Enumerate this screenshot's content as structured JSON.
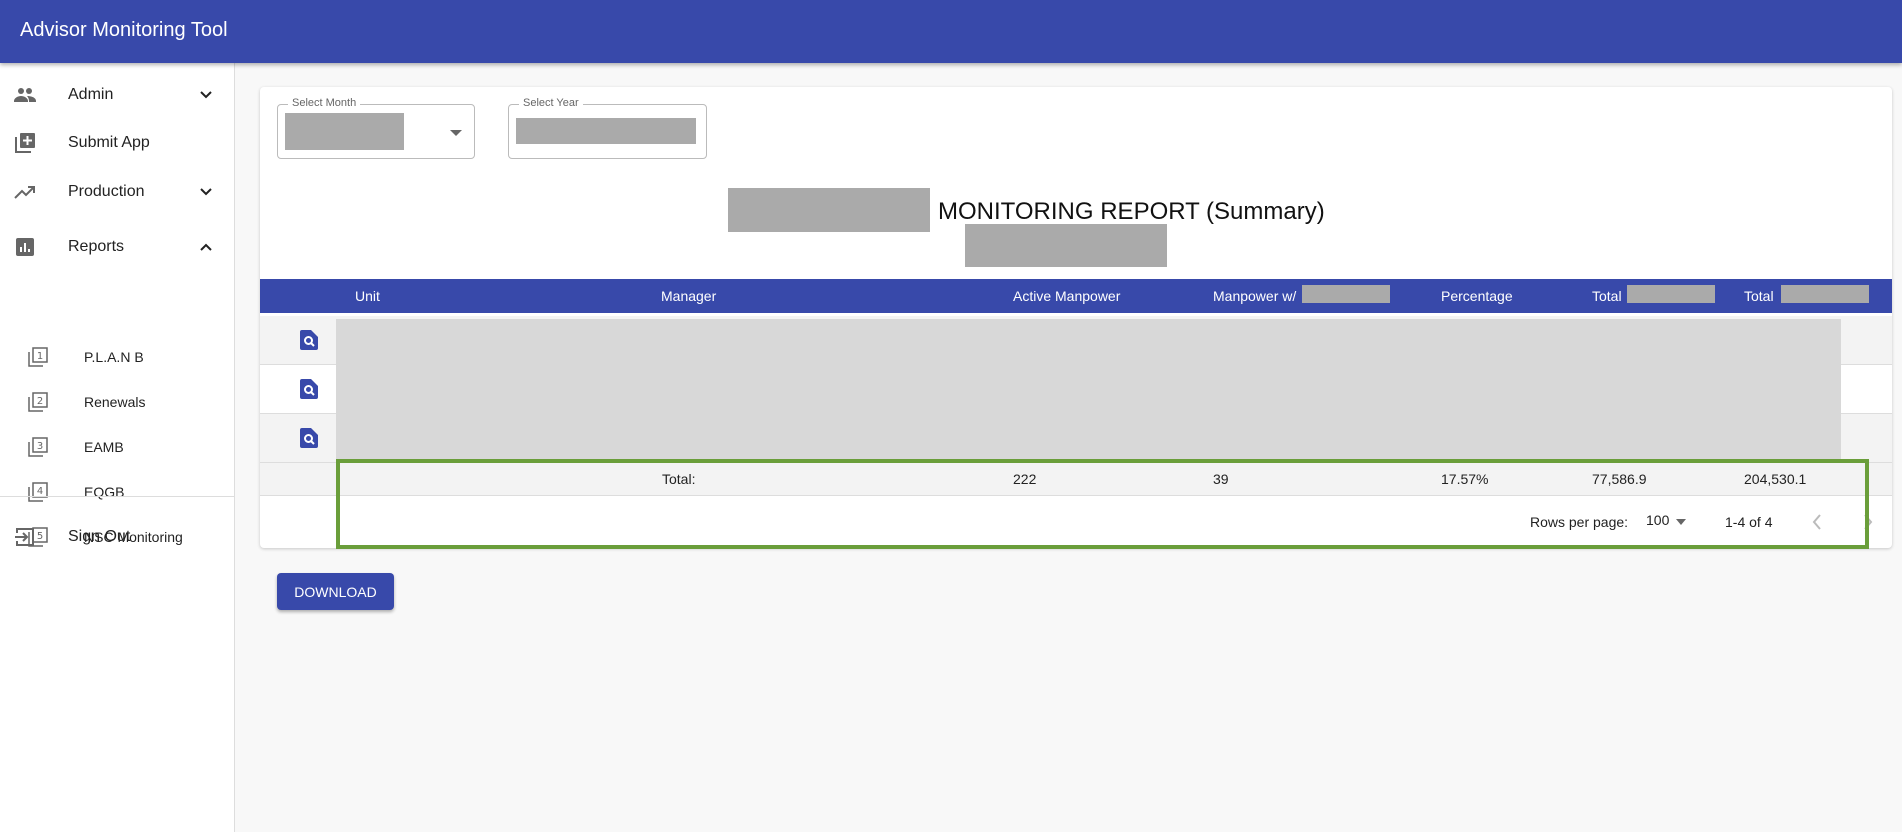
{
  "app": {
    "title": "Advisor Monitoring Tool"
  },
  "sidebar": {
    "items": [
      {
        "label": "Admin",
        "icon": "people-icon",
        "expand": "chevron-down"
      },
      {
        "label": "Submit App",
        "icon": "library-add-icon"
      },
      {
        "label": "Production",
        "icon": "trending-up-icon",
        "expand": "chevron-down"
      },
      {
        "label": "Reports",
        "icon": "bar-chart-icon",
        "expand": "chevron-up"
      }
    ],
    "subitems": [
      {
        "label": "P.L.A.N B",
        "icon": "filter-1-icon",
        "num": "1"
      },
      {
        "label": "Renewals",
        "icon": "filter-2-icon",
        "num": "2"
      },
      {
        "label": "EAMB",
        "icon": "filter-3-icon",
        "num": "3"
      },
      {
        "label": "EQGB",
        "icon": "filter-4-icon",
        "num": "4"
      },
      {
        "label": "NSC Monitoring",
        "icon": "filter-5-icon",
        "num": "5"
      }
    ],
    "signout": "Sign Out"
  },
  "filters": {
    "month_label": "Select Month",
    "year_label": "Select Year"
  },
  "report": {
    "title": "MONITORING REPORT (Summary)"
  },
  "table": {
    "headers": [
      "Unit",
      "Manager",
      "Active Manpower",
      "Manpower w/",
      "Percentage",
      "Total",
      "Total"
    ],
    "total_row": {
      "label": "Total:",
      "active_manpower": "222",
      "manpower_w": "39",
      "percentage": "17.57%",
      "total1": "77,586.9",
      "total2": "204,530.1"
    },
    "pagination": {
      "rows_per_page_label": "Rows per page:",
      "rows_per_page": "100",
      "range": "1-4 of 4"
    }
  },
  "download_label": "DOWNLOAD",
  "colors": {
    "primary": "#3849aa",
    "highlight": "#6a9e3a"
  }
}
